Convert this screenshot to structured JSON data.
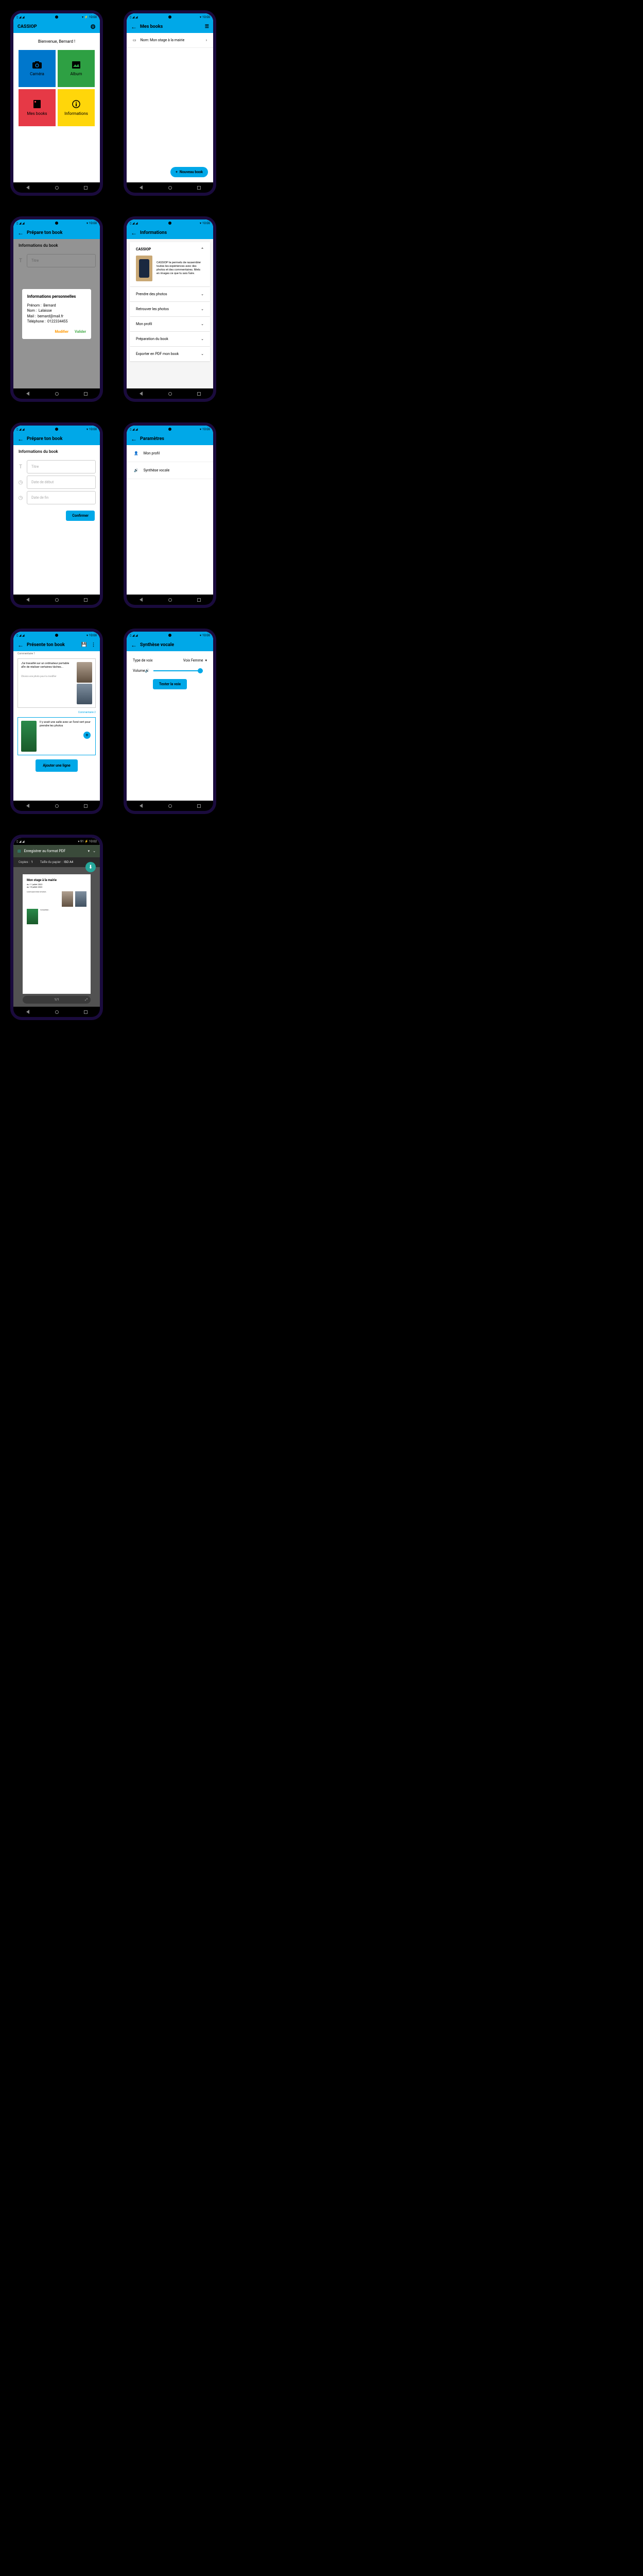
{
  "status": {
    "time": "10:00",
    "signal": "▫▫",
    "wifi_icon": "wifi",
    "battery": "80%"
  },
  "nav": {
    "back": "◀",
    "home": "●",
    "recent": "■"
  },
  "s1": {
    "title": "CASSIOP",
    "welcome": "Bienvenue, Bernard !",
    "tiles": {
      "camera": "Caméra",
      "album": "Album",
      "books": "Mes books",
      "info": "Informations"
    }
  },
  "s2": {
    "title": "Mes books",
    "item_label": "Nom: Mon stage à la mairie",
    "fab": "Nouveau book"
  },
  "s3": {
    "title": "Prépare ton book",
    "section": "Informations du book",
    "field_title": "Titre",
    "dialog_title": "Informations personnelles",
    "prenom_l": "Prénom :",
    "prenom_v": "Bernard",
    "nom_l": "Nom :",
    "nom_v": "Lalaisse",
    "mail_l": "Mail :",
    "mail_v": "bernard@mail.fr",
    "tel_l": "Téléphone :",
    "tel_v": "0122334455",
    "modify": "Modifier",
    "validate": "Valider"
  },
  "s4": {
    "title": "Informations",
    "app_name": "CASSIOP",
    "desc": "CASSIOP te permets de rassembler toutes les expériences avec des photos et des commentaires. Mets en images ce que tu sais faire.",
    "items": [
      "Prendre des photos",
      "Retrouver les photos",
      "Mon profil",
      "Préparation du book",
      "Exporter en PDF mon book"
    ]
  },
  "s5": {
    "title": "Prépare ton book",
    "section": "Informations du book",
    "f1": "Titre",
    "f2": "Date de début",
    "f3": "Date de fin",
    "confirm": "Confirmer"
  },
  "s6": {
    "title": "Paramètres",
    "r1": "Mon profil",
    "r2": "Synthèse vocale"
  },
  "s7": {
    "title": "Présente ton book",
    "c1_label": "Commentaire 1",
    "c1_text": "J'ai travaillé sur un ordinateur portable afin de réaliser certaines tâches...",
    "c1_hint": "Choisis une photo pour la modifier",
    "c2_label": "Commentaire 2",
    "c2_text": "Il y avait une salle avec un fond vert pour prendre les photos",
    "add": "Ajouter une ligne"
  },
  "s8": {
    "title": "Synthèse vocale",
    "type_l": "Type de voix",
    "type_v": "Voix Femme",
    "vol_l": "Volume",
    "test": "Tester la voix"
  },
  "s9": {
    "title": "Enregistrer au format PDF",
    "copies_l": "Copies :",
    "copies_v": "1",
    "size_l": "Taille du papier :",
    "size_v": "ISO A4",
    "doc_title": "Mon stage à la mairie",
    "doc_dates": "du 11 juillet 2022\nau 15 juillet 2022",
    "page": "1/1"
  }
}
